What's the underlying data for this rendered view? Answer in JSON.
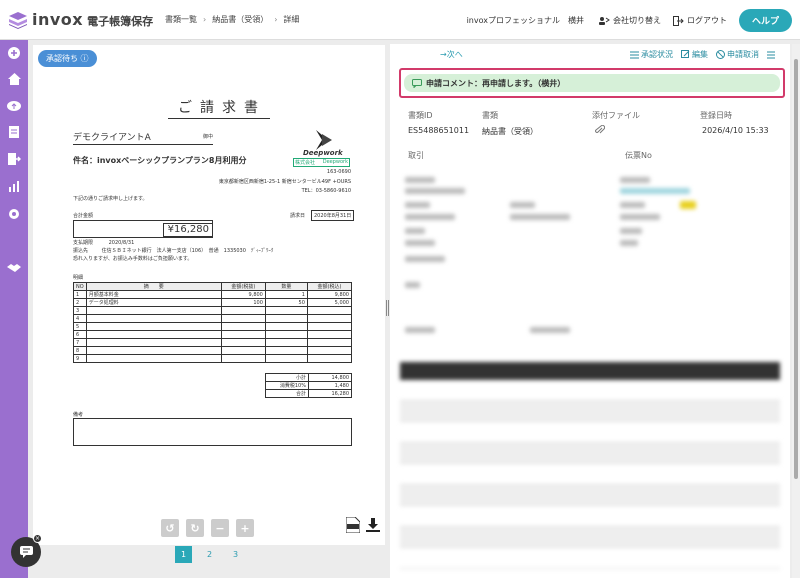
{
  "app": {
    "name": "invox",
    "subtitle": "電子帳簿保存"
  },
  "breadcrumb": [
    "書類一覧",
    "納品書（受領）",
    "詳細"
  ],
  "header": {
    "user": "invoxプロフェッショナル　横井",
    "switch_company": "会社切り替え",
    "logout": "ログアウト",
    "help": "ヘルプ"
  },
  "document": {
    "status": "承認待ち ⓘ",
    "title": "ご請求書",
    "client": "デモクライアントA",
    "honorific": "御中",
    "subject": "件名：invoxベーシックプランプラン8月利用分",
    "issuer_logo": "Deepwork",
    "issuer_stamp_left": "株式会社",
    "issuer_stamp_right": "Deepwork",
    "postal": "163-0690",
    "address": "東京都新宿区西新宿1-25-1 新宿センタービル49F +OURS",
    "tel": "TEL：03-5860-9610",
    "greeting": "下記の通りご請求申し上げます。",
    "total_label": "合計金額",
    "total": "¥16,280",
    "date_label": "請求日",
    "date": "2020年8月31日",
    "due_label": "支払期限",
    "due": "2020/8/31",
    "bank_label": "振込先",
    "bank": "住信ＳＢＩネット銀行　法人第一支店（106）　普通　1335030　ﾃﾞｨｰﾌﾟﾜｰｸ",
    "fee_note": "恐れ入りますが、お振込み手数料はご負担願います。",
    "items_label": "明細",
    "columns": [
      "NO",
      "摘　　要",
      "金額(税抜)",
      "数量",
      "金額(税込)"
    ],
    "rows": [
      [
        "1",
        "月額基本料金",
        "9,800",
        "1",
        "9,800"
      ],
      [
        "2",
        "データ処理料",
        "100",
        "50",
        "5,000"
      ],
      [
        "3",
        "",
        "",
        "",
        ""
      ],
      [
        "4",
        "",
        "",
        "",
        ""
      ],
      [
        "5",
        "",
        "",
        "",
        ""
      ],
      [
        "6",
        "",
        "",
        "",
        ""
      ],
      [
        "7",
        "",
        "",
        "",
        ""
      ],
      [
        "8",
        "",
        "",
        "",
        ""
      ],
      [
        "9",
        "",
        "",
        "",
        ""
      ]
    ],
    "subtotal_label": "小計",
    "subtotal": "14,800",
    "tax_label": "消費税10%",
    "tax": "1,480",
    "grand_label": "合計",
    "grand": "16,280",
    "remarks_label": "備考"
  },
  "pager": [
    "1",
    "2",
    "3"
  ],
  "detail": {
    "next": "→次へ",
    "actions": [
      "承認状況",
      "編集",
      "申請取消"
    ],
    "comment": "申請コメント：再申請します。（横井）",
    "fields": [
      {
        "label": "書類ID",
        "value": "ES5488651011"
      },
      {
        "label": "書類",
        "value": "納品書（受領）"
      },
      {
        "label": "添付ファイル",
        "value": ""
      },
      {
        "label": "登録日時",
        "value": "2026/4/10 15:33"
      }
    ],
    "field_trade": "取引",
    "field_slip": "伝票No"
  },
  "colors": {
    "sidebar": "#9a6fcf",
    "accent": "#2aa8b8",
    "status": "#4a8fd6",
    "comment_border": "#d23a6a",
    "comment_bg": "#d6f0d8"
  }
}
